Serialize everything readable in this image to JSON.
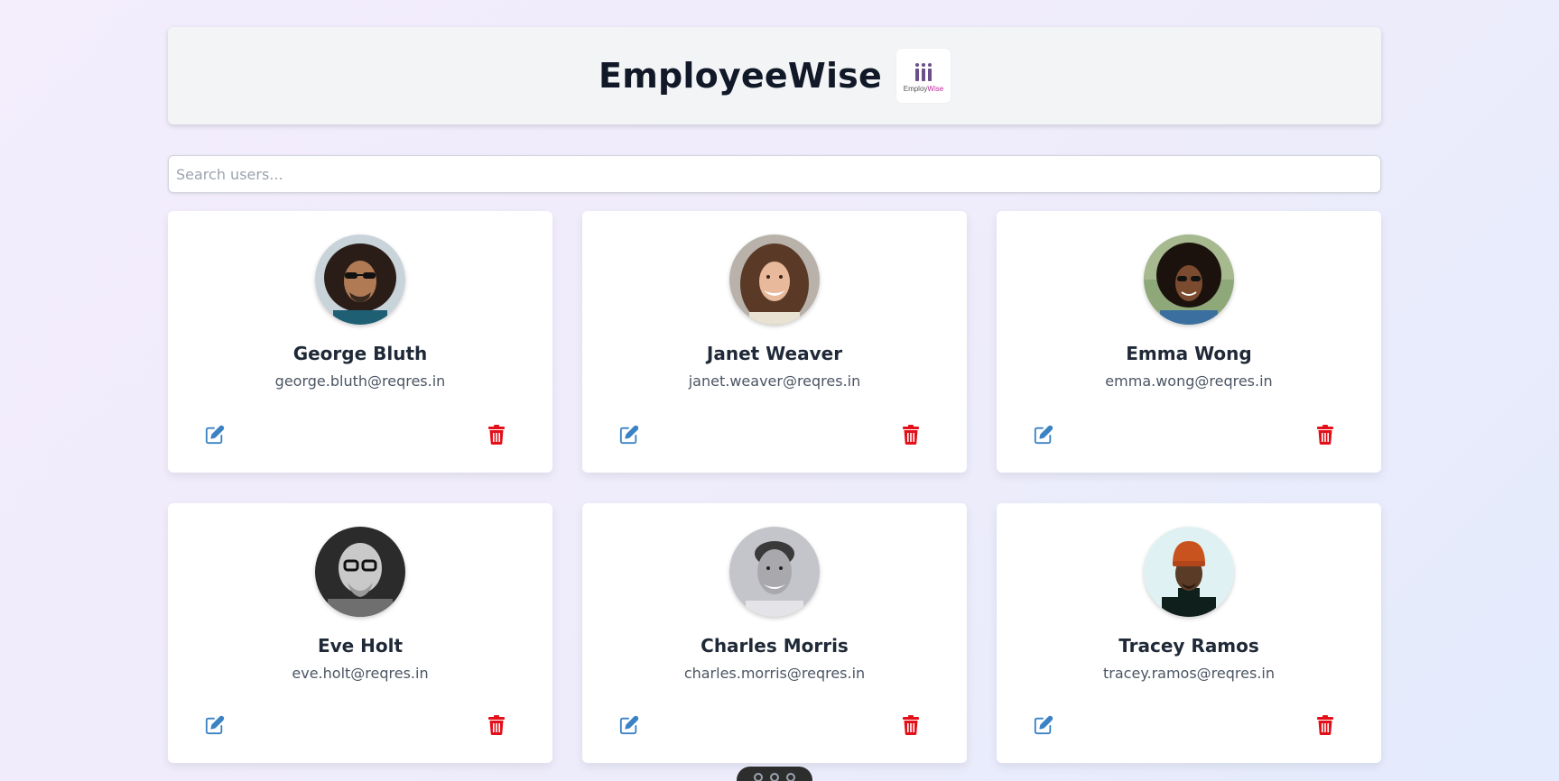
{
  "header": {
    "title": "EmployeeWise",
    "logo": {
      "text_prefix": "Employ",
      "text_suffix": "Wise",
      "accent": "#c0269b",
      "bar_color": "#6b4e8a"
    }
  },
  "search": {
    "placeholder": "Search users...",
    "value": ""
  },
  "users": [
    {
      "name": "George Bluth",
      "email": "george.bluth@reqres.in",
      "edit_icon": "edit-icon",
      "delete_icon": "trash-icon"
    },
    {
      "name": "Janet Weaver",
      "email": "janet.weaver@reqres.in",
      "edit_icon": "edit-icon",
      "delete_icon": "trash-icon"
    },
    {
      "name": "Emma Wong",
      "email": "emma.wong@reqres.in",
      "edit_icon": "edit-icon",
      "delete_icon": "trash-icon"
    },
    {
      "name": "Eve Holt",
      "email": "eve.holt@reqres.in",
      "edit_icon": "edit-icon",
      "delete_icon": "trash-icon"
    },
    {
      "name": "Charles Morris",
      "email": "charles.morris@reqres.in",
      "edit_icon": "edit-icon",
      "delete_icon": "trash-icon"
    },
    {
      "name": "Tracey Ramos",
      "email": "tracey.ramos@reqres.in",
      "edit_icon": "edit-icon",
      "delete_icon": "trash-icon"
    }
  ],
  "colors": {
    "edit": "#3b82c4",
    "delete": "#e3101a"
  }
}
